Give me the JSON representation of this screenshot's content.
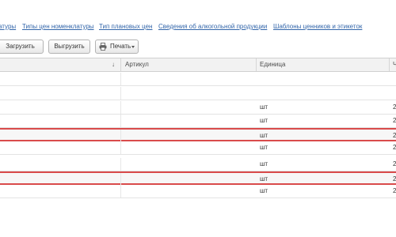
{
  "nav_links": [
    {
      "label": "атуры"
    },
    {
      "label": "Типы цен номенклатуры"
    },
    {
      "label": "Тип плановых цен"
    },
    {
      "label": "Сведения об алкогольной продукции"
    },
    {
      "label": "Шаблоны ценников и этикеток"
    }
  ],
  "toolbar": {
    "load_label": "Загрузить",
    "unload_label": "Выгрузить",
    "print_label": "Печать"
  },
  "grid": {
    "columns": [
      {
        "label": "",
        "sorted": "desc"
      },
      {
        "label": "Артикул"
      },
      {
        "label": "Единица"
      },
      {
        "label": "Ч"
      }
    ],
    "rows": [
      {
        "unit": "",
        "last": "",
        "highlighted": false
      },
      {
        "unit": "",
        "last": "",
        "highlighted": false
      },
      {
        "unit": "шт",
        "last": "2",
        "highlighted": false
      },
      {
        "unit": "шт",
        "last": "2",
        "highlighted": false
      },
      {
        "unit": "шт",
        "last": "2",
        "highlighted": true
      },
      {
        "unit": "шт",
        "last": "2",
        "highlighted": false
      },
      {
        "unit": "шт",
        "last": "2",
        "highlighted": false
      },
      {
        "unit": "шт",
        "last": "2",
        "highlighted": true
      },
      {
        "unit": "шт",
        "last": "2",
        "highlighted": false
      }
    ]
  },
  "colors": {
    "link": "#3366aa",
    "highlight_border": "#d94b4b"
  }
}
